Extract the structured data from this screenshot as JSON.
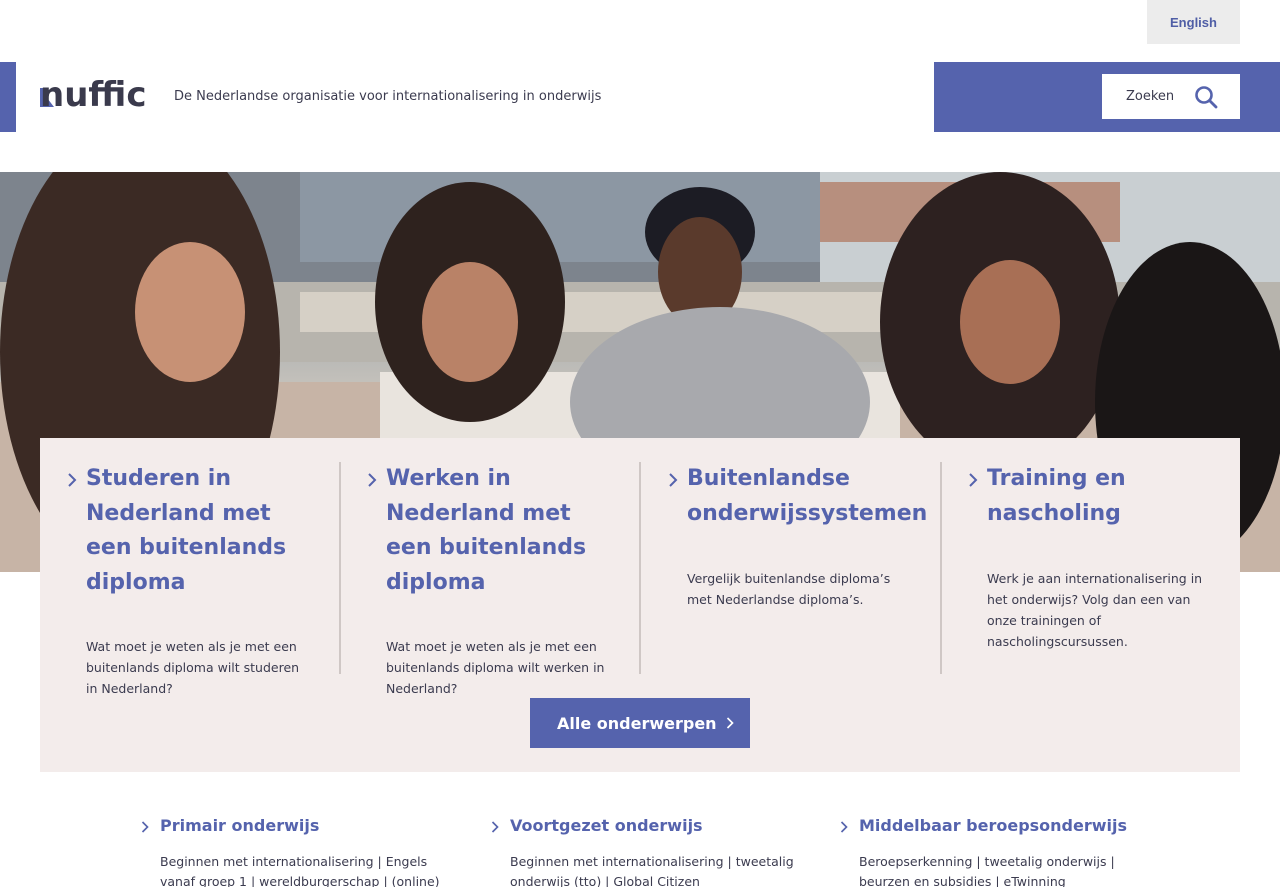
{
  "header": {
    "language_link": "English",
    "logo_text": "nuffic",
    "tagline": "De Nederlandse organisatie voor internationalisering in onderwijs",
    "search_label": "Zoeken"
  },
  "hero": {
    "image_alt": "Studenten aan tafel in een klaslokaal"
  },
  "topics": [
    {
      "title": "Studeren in Nederland met een buitenlands diploma",
      "description": "Wat moet je weten als je met een buitenlands diploma wilt studeren in Nederland?"
    },
    {
      "title": "Werken in Nederland met een buitenlands diploma",
      "description": "Wat moet je weten als je met een buitenlands diploma wilt werken in Nederland?"
    },
    {
      "title": "Buitenlandse onderwijssystemen",
      "description": "Vergelijk buitenlandse diploma’s met Nederlandse diploma’s."
    },
    {
      "title": "Training en nascholing",
      "description": "Werk je aan internationalisering in het onderwijs? Volg dan een van onze trainingen of nascholingscursussen."
    }
  ],
  "all_topics_button": "Alle onderwerpen",
  "sections": [
    {
      "title": "Primair onderwijs",
      "links": "Beginnen met internationalisering | Engels vanaf groep 1 | wereldburgerschap | (online)"
    },
    {
      "title": "Voortgezet onderwijs",
      "links": "Beginnen met internationalisering | tweetalig onderwijs (tto) | Global Citizen"
    },
    {
      "title": "Middelbaar beroepsonderwijs",
      "links": "Beroepserkenning | tweetalig onderwijs | beurzen en subsidies | eTwinning"
    }
  ],
  "colors": {
    "brand_blue": "#5563ad",
    "panel_bg": "#f3eceb",
    "logo_dark": "#3a3a4c"
  },
  "icons": {
    "search": "search-icon",
    "chevron": "chevron-right-icon"
  }
}
